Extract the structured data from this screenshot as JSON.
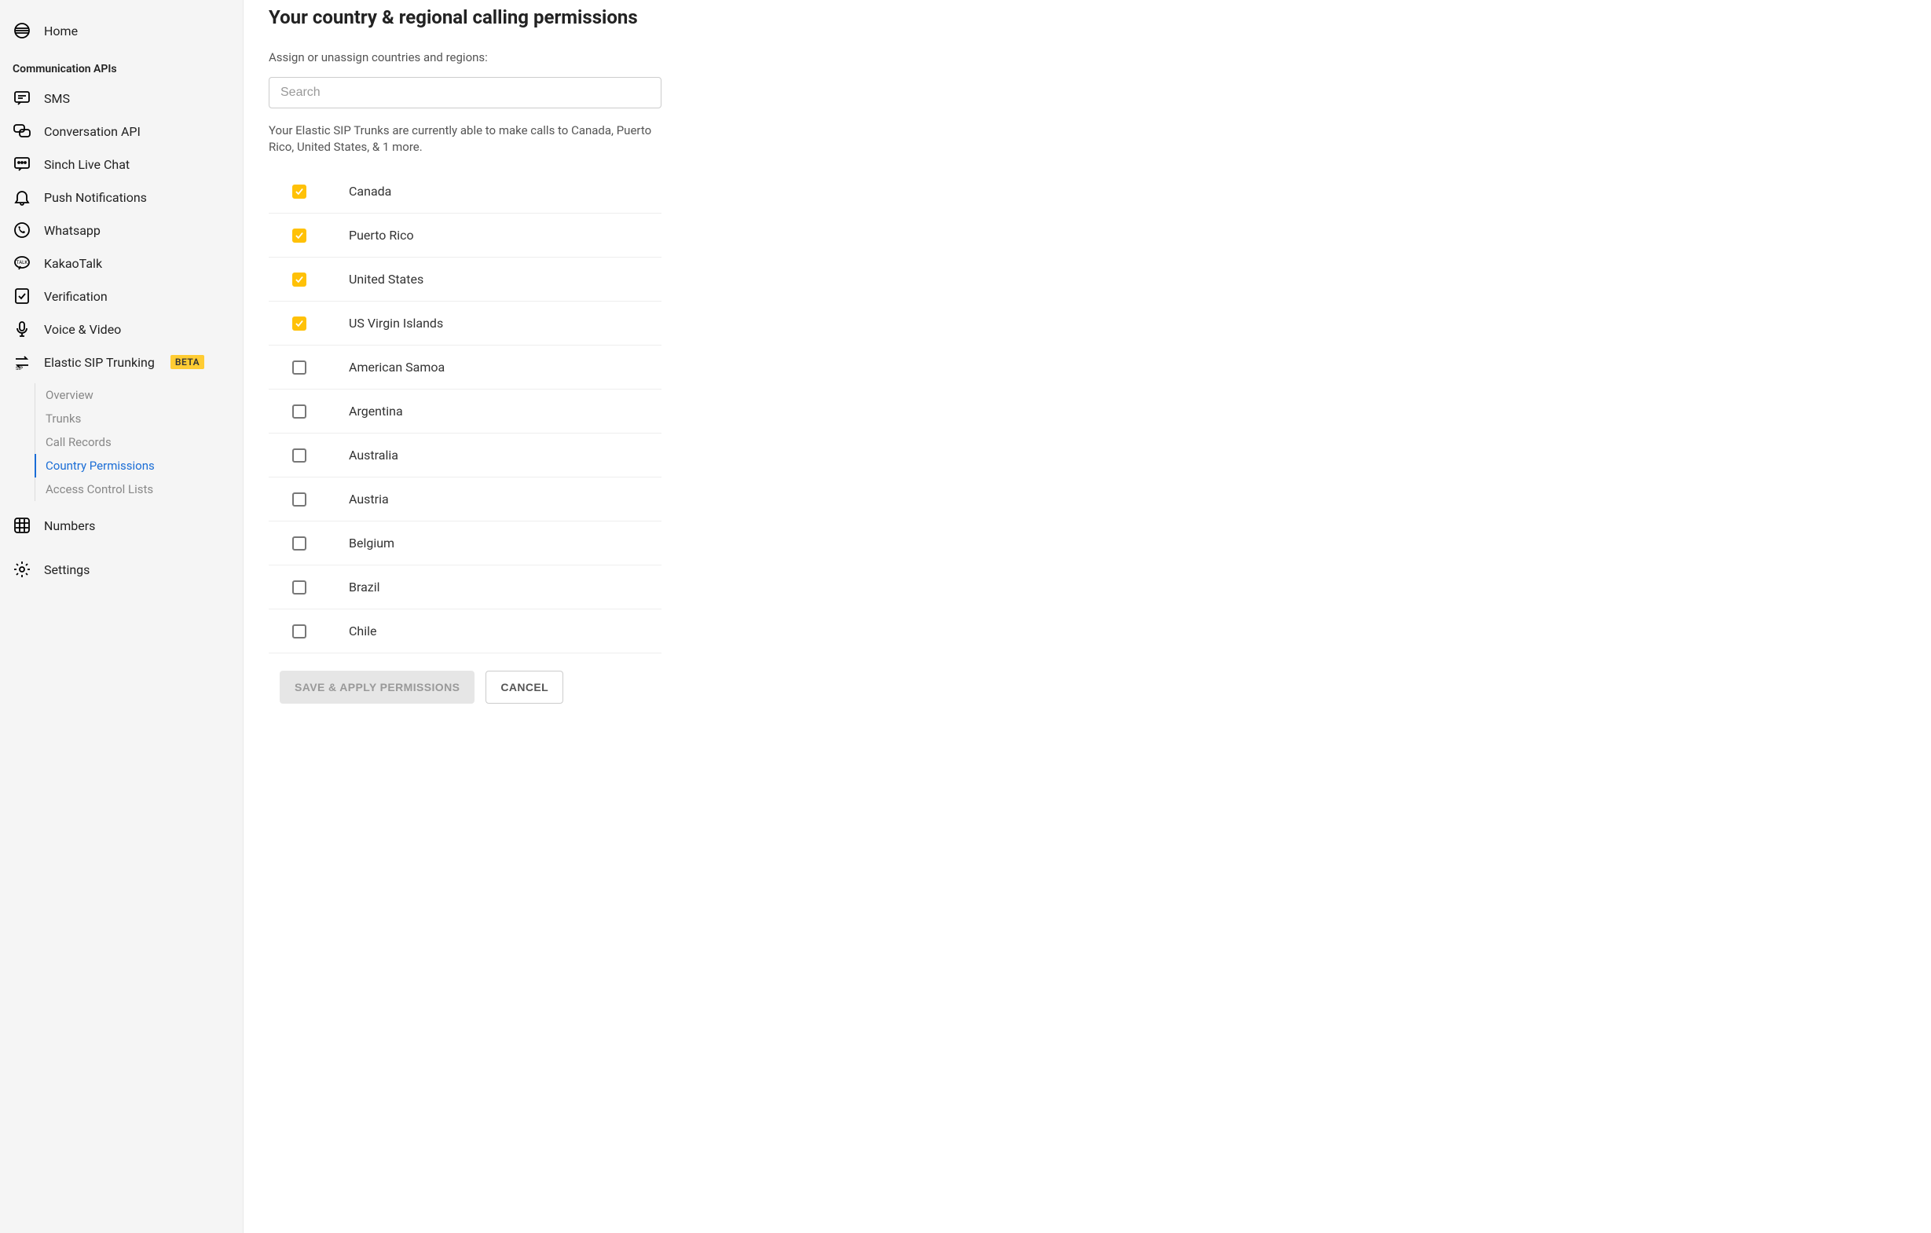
{
  "sidebar": {
    "home_label": "Home",
    "section_label": "Communication APIs",
    "items": [
      {
        "label": "SMS",
        "icon": "sms-icon"
      },
      {
        "label": "Conversation API",
        "icon": "conversation-icon"
      },
      {
        "label": "Sinch Live Chat",
        "icon": "livechat-icon"
      },
      {
        "label": "Push Notifications",
        "icon": "bell-icon"
      },
      {
        "label": "Whatsapp",
        "icon": "whatsapp-icon"
      },
      {
        "label": "KakaoTalk",
        "icon": "kakaotalk-icon"
      },
      {
        "label": "Verification",
        "icon": "verification-icon"
      },
      {
        "label": "Voice & Video",
        "icon": "voice-video-icon"
      },
      {
        "label": "Elastic SIP Trunking",
        "icon": "sip-trunking-icon",
        "badge": "BETA"
      }
    ],
    "sip_subitems": [
      {
        "label": "Overview",
        "active": false
      },
      {
        "label": "Trunks",
        "active": false
      },
      {
        "label": "Call Records",
        "active": false
      },
      {
        "label": "Country Permissions",
        "active": true
      },
      {
        "label": "Access Control Lists",
        "active": false
      }
    ],
    "numbers_label": "Numbers",
    "settings_label": "Settings"
  },
  "main": {
    "title": "Your country & regional calling permissions",
    "subtitle": "Assign or unassign countries and regions:",
    "search_placeholder": "Search",
    "status_text": "Your Elastic SIP Trunks are currently able to make calls to Canada, Puerto Rico, United States, & 1 more.",
    "countries": [
      {
        "name": "Canada",
        "checked": true
      },
      {
        "name": "Puerto Rico",
        "checked": true
      },
      {
        "name": "United States",
        "checked": true
      },
      {
        "name": "US Virgin Islands",
        "checked": true
      },
      {
        "name": "American Samoa",
        "checked": false
      },
      {
        "name": "Argentina",
        "checked": false
      },
      {
        "name": "Australia",
        "checked": false
      },
      {
        "name": "Austria",
        "checked": false
      },
      {
        "name": "Belgium",
        "checked": false
      },
      {
        "name": "Brazil",
        "checked": false
      },
      {
        "name": "Chile",
        "checked": false
      }
    ],
    "save_label": "SAVE & APPLY PERMISSIONS",
    "cancel_label": "CANCEL"
  }
}
